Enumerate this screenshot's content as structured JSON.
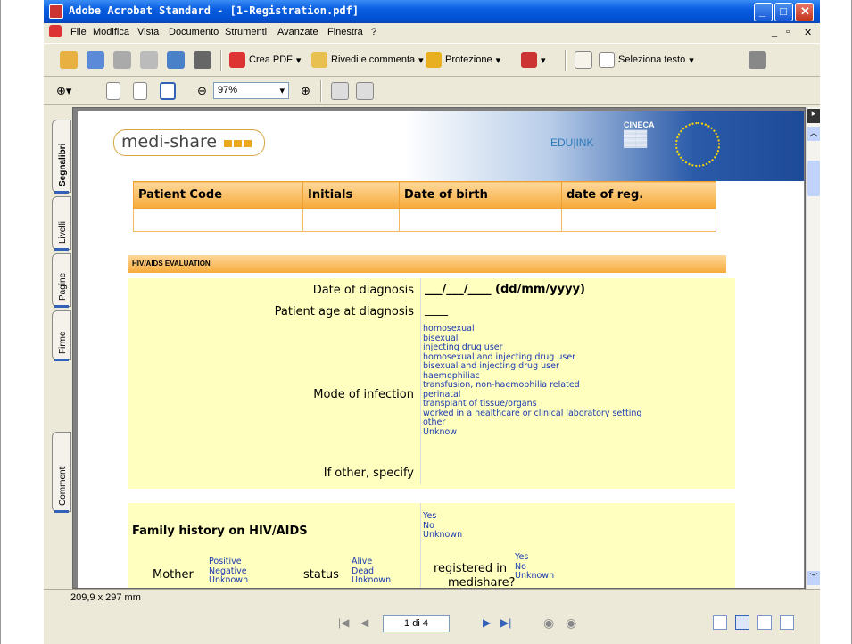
{
  "window": {
    "title": "Adobe Acrobat Standard - [1-Registration.pdf]"
  },
  "menu": [
    "File",
    "Modifica",
    "Vista",
    "Documento",
    "Strumenti",
    "Avanzate",
    "Finestra",
    "?"
  ],
  "toolbar": {
    "crea_pdf": "Crea PDF",
    "rivedi": "Rivedi e commenta",
    "protezione": "Protezione",
    "seleziona": "Seleziona testo"
  },
  "zoom": {
    "value": "97%"
  },
  "sidetabs": [
    "Segnalibri",
    "Livelli",
    "Pagine",
    "Firme",
    "Commenti"
  ],
  "document": {
    "logo": "medi-share",
    "edulink": "EDU|INK",
    "cineca": "CINECA",
    "patient_table": {
      "headers": [
        "Patient Code",
        "Initials",
        "Date of birth",
        "date of reg."
      ]
    },
    "section_title": "HIV/AIDS EVALUATION",
    "date_label": "Date of diagnosis",
    "date_value": "___/___/____ (dd/mm/yyyy)",
    "age_label": "Patient age at diagnosis",
    "age_value": "____",
    "mode_label": "Mode of infection",
    "mode_options": [
      "homosexual",
      "bisexual",
      "injecting drug user",
      "homosexual and injecting drug user",
      "bisexual and injecting drug user",
      "haemophiliac",
      "transfusion, non-haemophilia related",
      "perinatal",
      "transplant of tissue/organs",
      "worked in a healthcare or clinical laboratory setting",
      "other",
      "Unknow"
    ],
    "other_label": "If other, specify",
    "family_label": "Family history on HIV/AIDS",
    "family_options": [
      "Yes",
      "No",
      "Unknown"
    ],
    "mother_label": "Mother",
    "mother_options": [
      "Positive",
      "Negative",
      "Unknown"
    ],
    "status_label": "status",
    "status_options": [
      "Alive",
      "Dead",
      "Unknown"
    ],
    "registered_label1": "registered in",
    "registered_label2": "medishare?",
    "registered_options": [
      "Yes",
      "No",
      "Unknown"
    ]
  },
  "status": {
    "page_size": "209,9 x 297 mm"
  },
  "nav": {
    "page": "1 di 4"
  }
}
